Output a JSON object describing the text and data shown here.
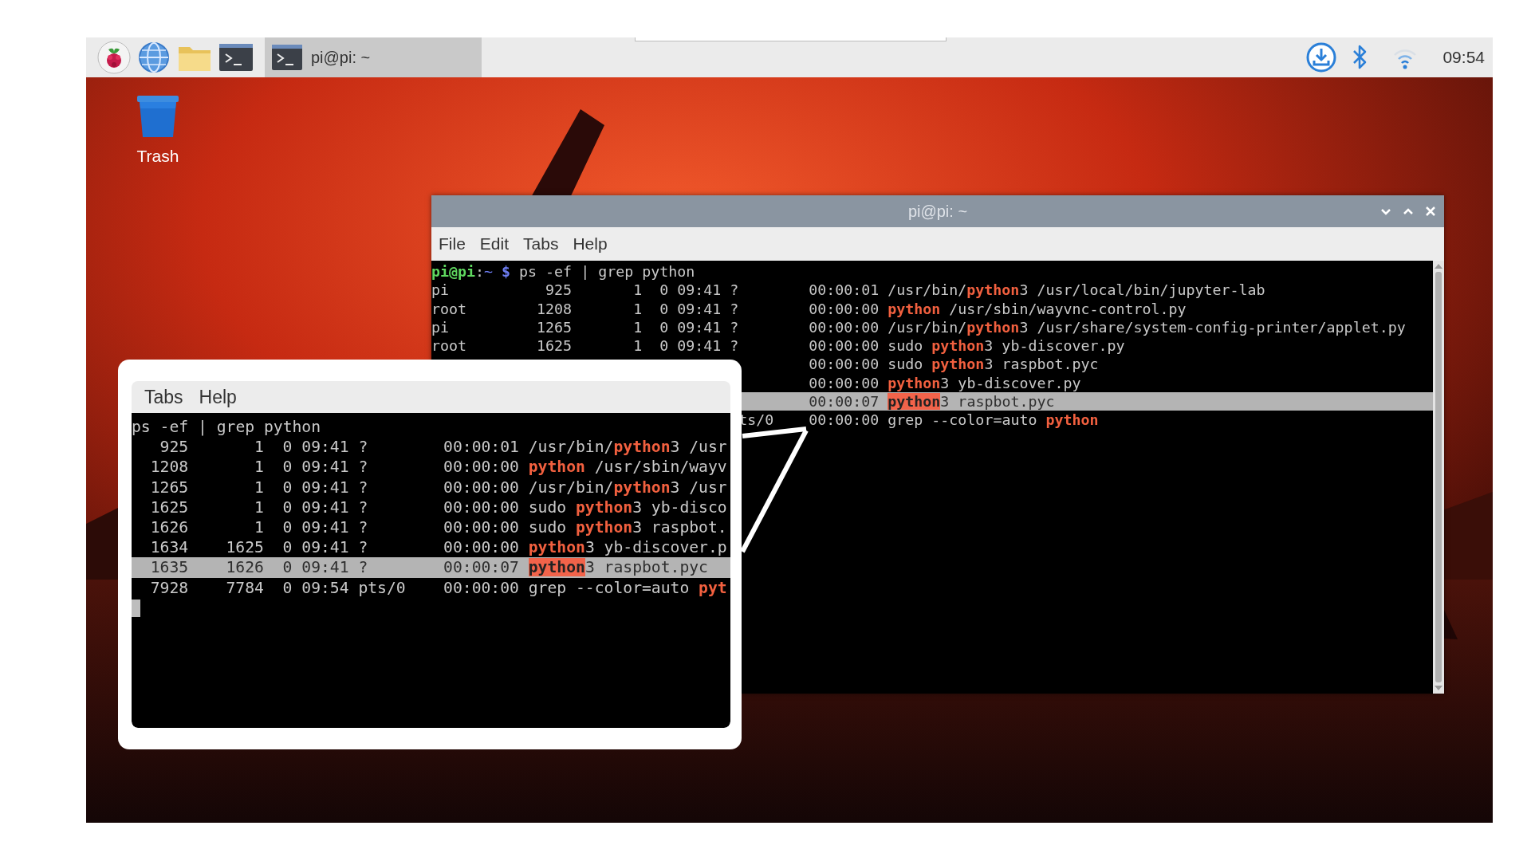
{
  "taskbar": {
    "task_button": {
      "label": "pi@pi: ~"
    },
    "clock": "09:54"
  },
  "desktop_icons": [
    {
      "label": "Trash"
    }
  ],
  "terminal": {
    "title": "pi@pi: ~",
    "menu": [
      "File",
      "Edit",
      "Tabs",
      "Help"
    ],
    "prompt": {
      "user_host": "pi@pi",
      "separator": ":",
      "path": "~",
      "symbol": "$",
      "command": "ps -ef | grep python"
    },
    "rows": [
      {
        "kind": "full",
        "selected": false,
        "uid": "pi",
        "pid": "925",
        "ppid": "1",
        "c": "0",
        "stime": "09:41",
        "tty": "?",
        "time": "00:00:01",
        "command": [
          {
            "text": "/usr/bin/",
            "match": false
          },
          {
            "text": "python",
            "match": true
          },
          {
            "text": "3 /usr/local/bin/jupyter-lab",
            "match": false
          }
        ]
      },
      {
        "kind": "full",
        "selected": false,
        "uid": "root",
        "pid": "1208",
        "ppid": "1",
        "c": "0",
        "stime": "09:41",
        "tty": "?",
        "time": "00:00:00",
        "command": [
          {
            "text": "python",
            "match": true
          },
          {
            "text": " /usr/sbin/wayvnc-control.py",
            "match": false
          }
        ]
      },
      {
        "kind": "full",
        "selected": false,
        "uid": "pi",
        "pid": "1265",
        "ppid": "1",
        "c": "0",
        "stime": "09:41",
        "tty": "?",
        "time": "00:00:00",
        "command": [
          {
            "text": "/usr/bin/",
            "match": false
          },
          {
            "text": "python",
            "match": true
          },
          {
            "text": "3 /usr/share/system-config-printer/applet.py",
            "match": false
          }
        ]
      },
      {
        "kind": "full",
        "selected": false,
        "uid": "root",
        "pid": "1625",
        "ppid": "1",
        "c": "0",
        "stime": "09:41",
        "tty": "?",
        "time": "00:00:00",
        "command": [
          {
            "text": "sudo ",
            "match": false
          },
          {
            "text": "python",
            "match": true
          },
          {
            "text": "3 yb-discover.py",
            "match": false
          }
        ]
      },
      {
        "kind": "cut",
        "selected": false,
        "time": "00:00:00",
        "command": [
          {
            "text": "sudo ",
            "match": false
          },
          {
            "text": "python",
            "match": true
          },
          {
            "text": "3 raspbot.pyc",
            "match": false
          }
        ]
      },
      {
        "kind": "cut",
        "selected": false,
        "time": "00:00:00",
        "command": [
          {
            "text": "python",
            "match": true
          },
          {
            "text": "3 yb-discover.py",
            "match": false
          }
        ]
      },
      {
        "kind": "cut",
        "selected": true,
        "time": "00:00:07",
        "command": [
          {
            "text": "python",
            "match": true
          },
          {
            "text": "3 raspbot.pyc",
            "match": false
          }
        ]
      },
      {
        "kind": "cut",
        "selected": false,
        "tty": "ts/0",
        "time": "00:00:00",
        "command": [
          {
            "text": "grep --color=auto ",
            "match": false
          },
          {
            "text": "python",
            "match": true
          }
        ]
      }
    ]
  },
  "callout": {
    "menu": [
      "Tabs",
      "Help"
    ],
    "command": "ps -ef | grep python",
    "rows": [
      {
        "kind": "full",
        "selected": false,
        "pid": "925",
        "ppid": "1",
        "c": "0",
        "stime": "09:41",
        "tty": "?",
        "time": "00:00:01",
        "command": [
          {
            "text": "/usr/bin/",
            "match": false
          },
          {
            "text": "python",
            "match": true
          },
          {
            "text": "3 /usr",
            "match": false
          }
        ]
      },
      {
        "kind": "full",
        "selected": false,
        "pid": "1208",
        "ppid": "1",
        "c": "0",
        "stime": "09:41",
        "tty": "?",
        "time": "00:00:00",
        "command": [
          {
            "text": "python",
            "match": true
          },
          {
            "text": " /usr/sbin/wayv",
            "match": false
          }
        ]
      },
      {
        "kind": "full",
        "selected": false,
        "pid": "1265",
        "ppid": "1",
        "c": "0",
        "stime": "09:41",
        "tty": "?",
        "time": "00:00:00",
        "command": [
          {
            "text": "/usr/bin/",
            "match": false
          },
          {
            "text": "python",
            "match": true
          },
          {
            "text": "3 /usr",
            "match": false
          }
        ]
      },
      {
        "kind": "full",
        "selected": false,
        "pid": "1625",
        "ppid": "1",
        "c": "0",
        "stime": "09:41",
        "tty": "?",
        "time": "00:00:00",
        "command": [
          {
            "text": "sudo ",
            "match": false
          },
          {
            "text": "python",
            "match": true
          },
          {
            "text": "3 yb-disco",
            "match": false
          }
        ]
      },
      {
        "kind": "full",
        "selected": false,
        "pid": "1626",
        "ppid": "1",
        "c": "0",
        "stime": "09:41",
        "tty": "?",
        "time": "00:00:00",
        "command": [
          {
            "text": "sudo ",
            "match": false
          },
          {
            "text": "python",
            "match": true
          },
          {
            "text": "3 raspbot.",
            "match": false
          }
        ]
      },
      {
        "kind": "full",
        "selected": false,
        "pid": "1634",
        "ppid": "1625",
        "c": "0",
        "stime": "09:41",
        "tty": "?",
        "time": "00:00:00",
        "command": [
          {
            "text": "python",
            "match": true
          },
          {
            "text": "3 yb-discover.p",
            "match": false
          }
        ]
      },
      {
        "kind": "full",
        "selected": true,
        "pid": "1635",
        "ppid": "1626",
        "c": "0",
        "stime": "09:41",
        "tty": "?",
        "time": "00:00:07",
        "command": [
          {
            "text": "python",
            "match": true
          },
          {
            "text": "3 raspbot.pyc",
            "match": false
          }
        ]
      },
      {
        "kind": "full",
        "selected": false,
        "pid": "7928",
        "ppid": "7784",
        "c": "0",
        "stime": "09:54",
        "tty": "pts/0",
        "time": "00:00:00",
        "command": [
          {
            "text": "grep --color=auto ",
            "match": false
          },
          {
            "text": "pyt",
            "match": true
          }
        ]
      }
    ]
  }
}
